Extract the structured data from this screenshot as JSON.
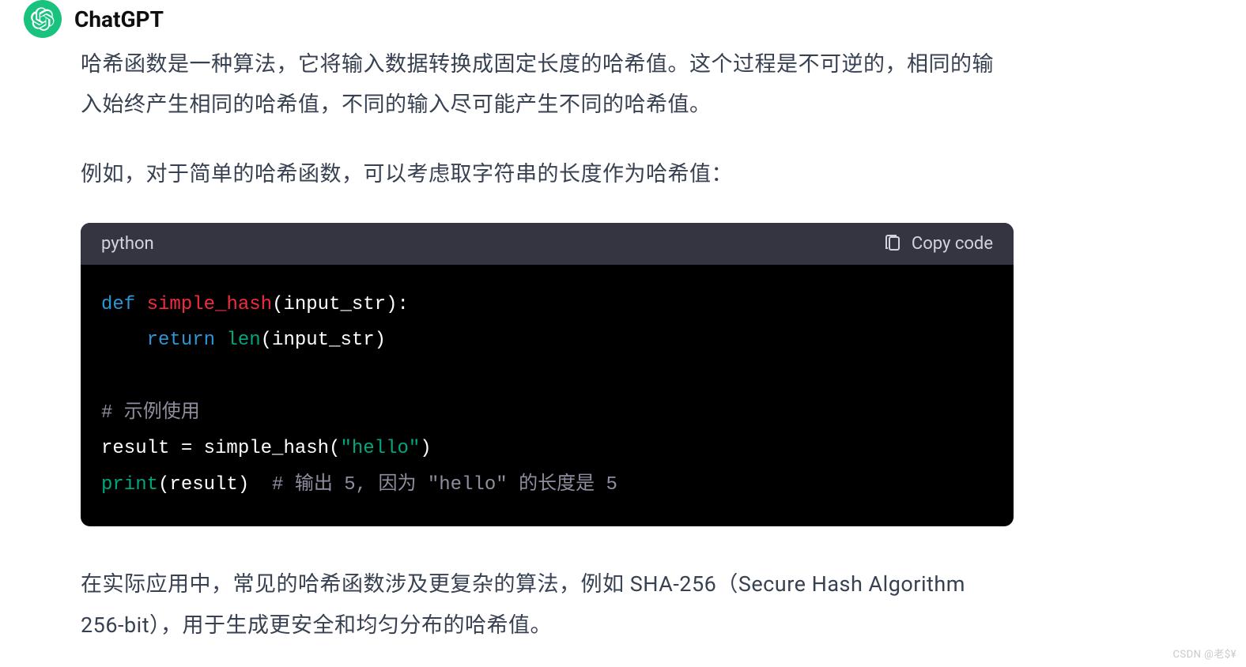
{
  "sender": "ChatGPT",
  "paragraphs": {
    "p1": "哈希函数是一种算法，它将输入数据转换成固定长度的哈希值。这个过程是不可逆的，相同的输入始终产生相同的哈希值，不同的输入尽可能产生不同的哈希值。",
    "p2": "例如，对于简单的哈希函数，可以考虑取字符串的长度作为哈希值：",
    "p3": "在实际应用中，常见的哈希函数涉及更复杂的算法，例如 SHA-256（Secure Hash Algorithm 256-bit），用于生成更安全和均匀分布的哈希值。"
  },
  "code": {
    "language": "python",
    "copy_label": "Copy code",
    "tokens": {
      "def": "def",
      "funcname": "simple_hash",
      "params": "(input_str):",
      "indent": "    ",
      "return": "return",
      "len": "len",
      "lenargs": "(input_str)",
      "comment1": "# 示例使用",
      "result_assign": "result = simple_hash(",
      "hello": "\"hello\"",
      "close_paren": ")",
      "print": "print",
      "printargs": "(result)  ",
      "comment2": "# 输出 5, 因为 \"hello\" 的长度是 5"
    }
  },
  "watermark": "CSDN @老$¥"
}
